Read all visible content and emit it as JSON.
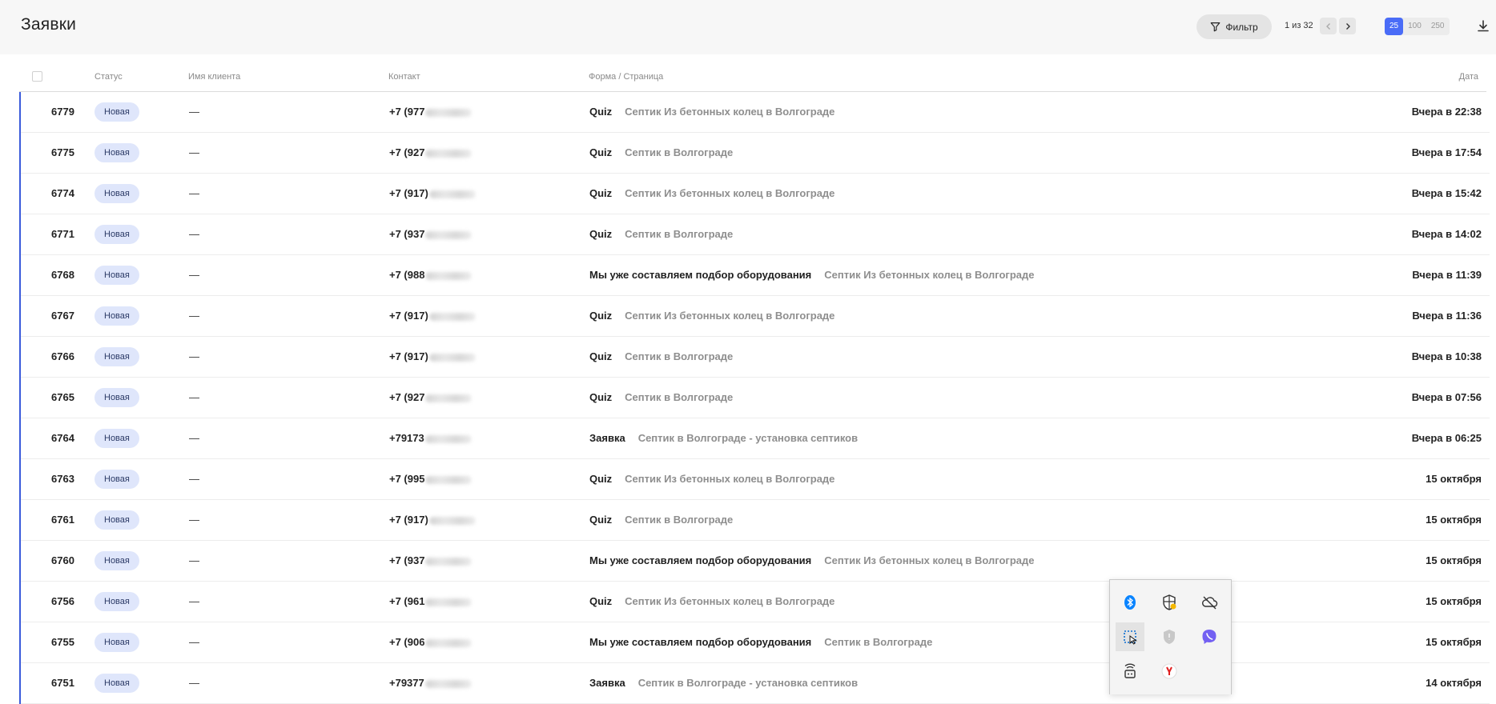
{
  "header": {
    "title": "Заявки",
    "filter_label": "Фильтр",
    "page_info": "1 из 32",
    "page_sizes": [
      "25",
      "100",
      "250"
    ],
    "active_page_size": "25"
  },
  "columns": {
    "status": "Статус",
    "client": "Имя клиента",
    "contact": "Контакт",
    "form": "Форма / Страница",
    "date": "Дата"
  },
  "rows": [
    {
      "id": "6779",
      "status": "Новая",
      "client": "—",
      "phone": "+7 (977",
      "form": "Quiz",
      "page": "Септик Из бетонных колец в Волгограде",
      "date": "Вчера в 22:38"
    },
    {
      "id": "6775",
      "status": "Новая",
      "client": "—",
      "phone": "+7 (927",
      "form": "Quiz",
      "page": "Септик в Волгограде",
      "date": "Вчера в 17:54"
    },
    {
      "id": "6774",
      "status": "Новая",
      "client": "—",
      "phone": "+7 (917)",
      "form": "Quiz",
      "page": "Септик Из бетонных колец в Волгограде",
      "date": "Вчера в 15:42"
    },
    {
      "id": "6771",
      "status": "Новая",
      "client": "—",
      "phone": "+7 (937",
      "form": "Quiz",
      "page": "Септик в Волгограде",
      "date": "Вчера в 14:02"
    },
    {
      "id": "6768",
      "status": "Новая",
      "client": "—",
      "phone": "+7 (988",
      "form": "Мы уже составляем подбор оборудования",
      "page": "Септик Из бетонных колец в Волгограде",
      "date": "Вчера в 11:39"
    },
    {
      "id": "6767",
      "status": "Новая",
      "client": "—",
      "phone": "+7 (917)",
      "form": "Quiz",
      "page": "Септик Из бетонных колец в Волгограде",
      "date": "Вчера в 11:36"
    },
    {
      "id": "6766",
      "status": "Новая",
      "client": "—",
      "phone": "+7 (917)",
      "form": "Quiz",
      "page": "Септик в Волгограде",
      "date": "Вчера в 10:38"
    },
    {
      "id": "6765",
      "status": "Новая",
      "client": "—",
      "phone": "+7 (927",
      "form": "Quiz",
      "page": "Септик в Волгограде",
      "date": "Вчера в 07:56"
    },
    {
      "id": "6764",
      "status": "Новая",
      "client": "—",
      "phone": "+79173",
      "form": "Заявка",
      "page": "Септик в Волгограде - установка септиков",
      "date": "Вчера в 06:25"
    },
    {
      "id": "6763",
      "status": "Новая",
      "client": "—",
      "phone": "+7 (995",
      "form": "Quiz",
      "page": "Септик Из бетонных колец в Волгограде",
      "date": "15 октября"
    },
    {
      "id": "6761",
      "status": "Новая",
      "client": "—",
      "phone": "+7 (917)",
      "form": "Quiz",
      "page": "Септик в Волгограде",
      "date": "15 октября"
    },
    {
      "id": "6760",
      "status": "Новая",
      "client": "—",
      "phone": "+7 (937",
      "form": "Мы уже составляем подбор оборудования",
      "page": "Септик Из бетонных колец в Волгограде",
      "date": "15 октября"
    },
    {
      "id": "6756",
      "status": "Новая",
      "client": "—",
      "phone": "+7 (961",
      "form": "Quiz",
      "page": "Септик Из бетонных колец в Волгограде",
      "date": "15 октября"
    },
    {
      "id": "6755",
      "status": "Новая",
      "client": "—",
      "phone": "+7 (906",
      "form": "Мы уже составляем подбор оборудования",
      "page": "Септик в Волгограде",
      "date": "15 октября"
    },
    {
      "id": "6751",
      "status": "Новая",
      "client": "—",
      "phone": "+79377",
      "form": "Заявка",
      "page": "Септик в Волгограде - установка септиков",
      "date": "14 октября"
    }
  ],
  "tray": {
    "icons": [
      "bluetooth-icon",
      "defender-icon",
      "onedrive-icon",
      "snipping-tool-icon",
      "security-shield-icon",
      "viber-icon",
      "network-device-icon",
      "yandex-browser-icon"
    ]
  },
  "colors": {
    "accent": "#3b5bdb",
    "status_badge": "#dfe6fb",
    "page_size_active": "#4a6cf7"
  }
}
